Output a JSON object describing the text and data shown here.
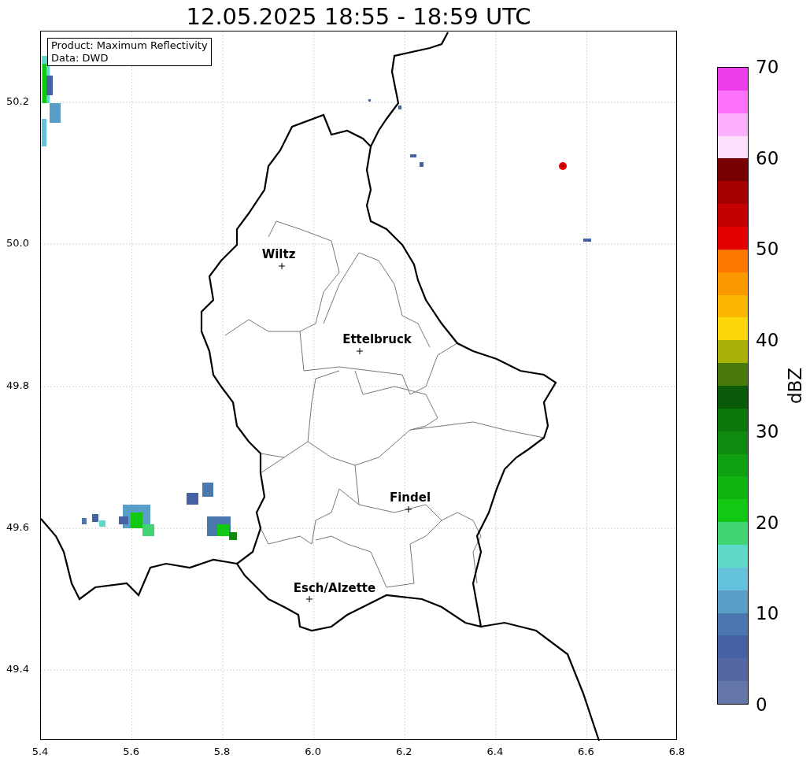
{
  "title": "12.05.2025 18:55 - 18:59 UTC",
  "legend": [
    "Product: Maximum Reflectivity",
    "Data: DWD"
  ],
  "cities": [
    {
      "name": "Wiltz"
    },
    {
      "name": "Ettelbruck"
    },
    {
      "name": "Findel"
    },
    {
      "name": "Esch/Alzette"
    }
  ],
  "x_ticks": [
    "5.4",
    "5.6",
    "5.8",
    "6.0",
    "6.2",
    "6.4",
    "6.6",
    "6.8"
  ],
  "y_ticks": [
    "50.2",
    "50.0",
    "49.8",
    "49.6",
    "49.4"
  ],
  "colorbar": {
    "label": "dBZ",
    "ticks": [
      "70",
      "60",
      "50",
      "40",
      "30",
      "20",
      "10",
      "0"
    ],
    "segments": [
      {
        "color": "#ec3cec"
      },
      {
        "color": "#fc70fc"
      },
      {
        "color": "#fcb0fc"
      },
      {
        "color": "#fce0fc"
      },
      {
        "color": "#780000"
      },
      {
        "color": "#a40000"
      },
      {
        "color": "#c40000"
      },
      {
        "color": "#e40000"
      },
      {
        "color": "#fc7800"
      },
      {
        "color": "#fc9800"
      },
      {
        "color": "#fcb800"
      },
      {
        "color": "#fcd808"
      },
      {
        "color": "#aab208"
      },
      {
        "color": "#4a7a0a"
      },
      {
        "color": "#0a5a0a"
      },
      {
        "color": "#0c780c"
      },
      {
        "color": "#0e8a0e"
      },
      {
        "color": "#0ea00e"
      },
      {
        "color": "#10b410"
      },
      {
        "color": "#12c812"
      },
      {
        "color": "#40d474"
      },
      {
        "color": "#5ed8c8"
      },
      {
        "color": "#64c2dc"
      },
      {
        "color": "#5a9ec8"
      },
      {
        "color": "#4a78ae"
      },
      {
        "color": "#4461a2"
      },
      {
        "color": "#5467a2"
      },
      {
        "color": "#6476a8"
      }
    ]
  }
}
